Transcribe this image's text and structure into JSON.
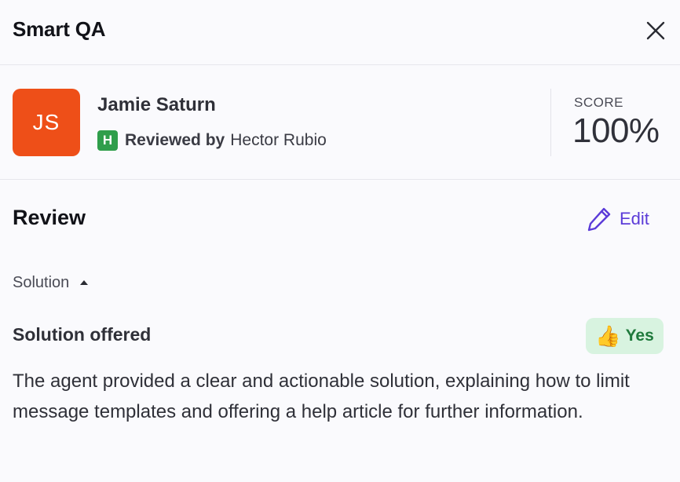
{
  "header": {
    "title": "Smart QA"
  },
  "agent": {
    "initials": "JS",
    "name": "Jamie Saturn",
    "reviewer_badge": "H",
    "reviewed_by_label": "Reviewed by",
    "reviewer_name": "Hector Rubio"
  },
  "score": {
    "label": "SCORE",
    "value": "100%"
  },
  "review": {
    "heading": "Review",
    "edit_label": "Edit",
    "section_label": "Solution",
    "criterion_title": "Solution offered",
    "result_label": "Yes",
    "result_icon": "thumbs-up-icon",
    "explanation": "The agent provided a clear and actionable solution, explaining how to limit message templates and offering a help article for further information."
  },
  "colors": {
    "avatar_bg": "#ee4f18",
    "reviewer_badge_bg": "#2f9e4b",
    "accent": "#5b3bd8",
    "yes_badge_bg": "#d8f3e0",
    "yes_badge_text": "#1f7a3c"
  }
}
